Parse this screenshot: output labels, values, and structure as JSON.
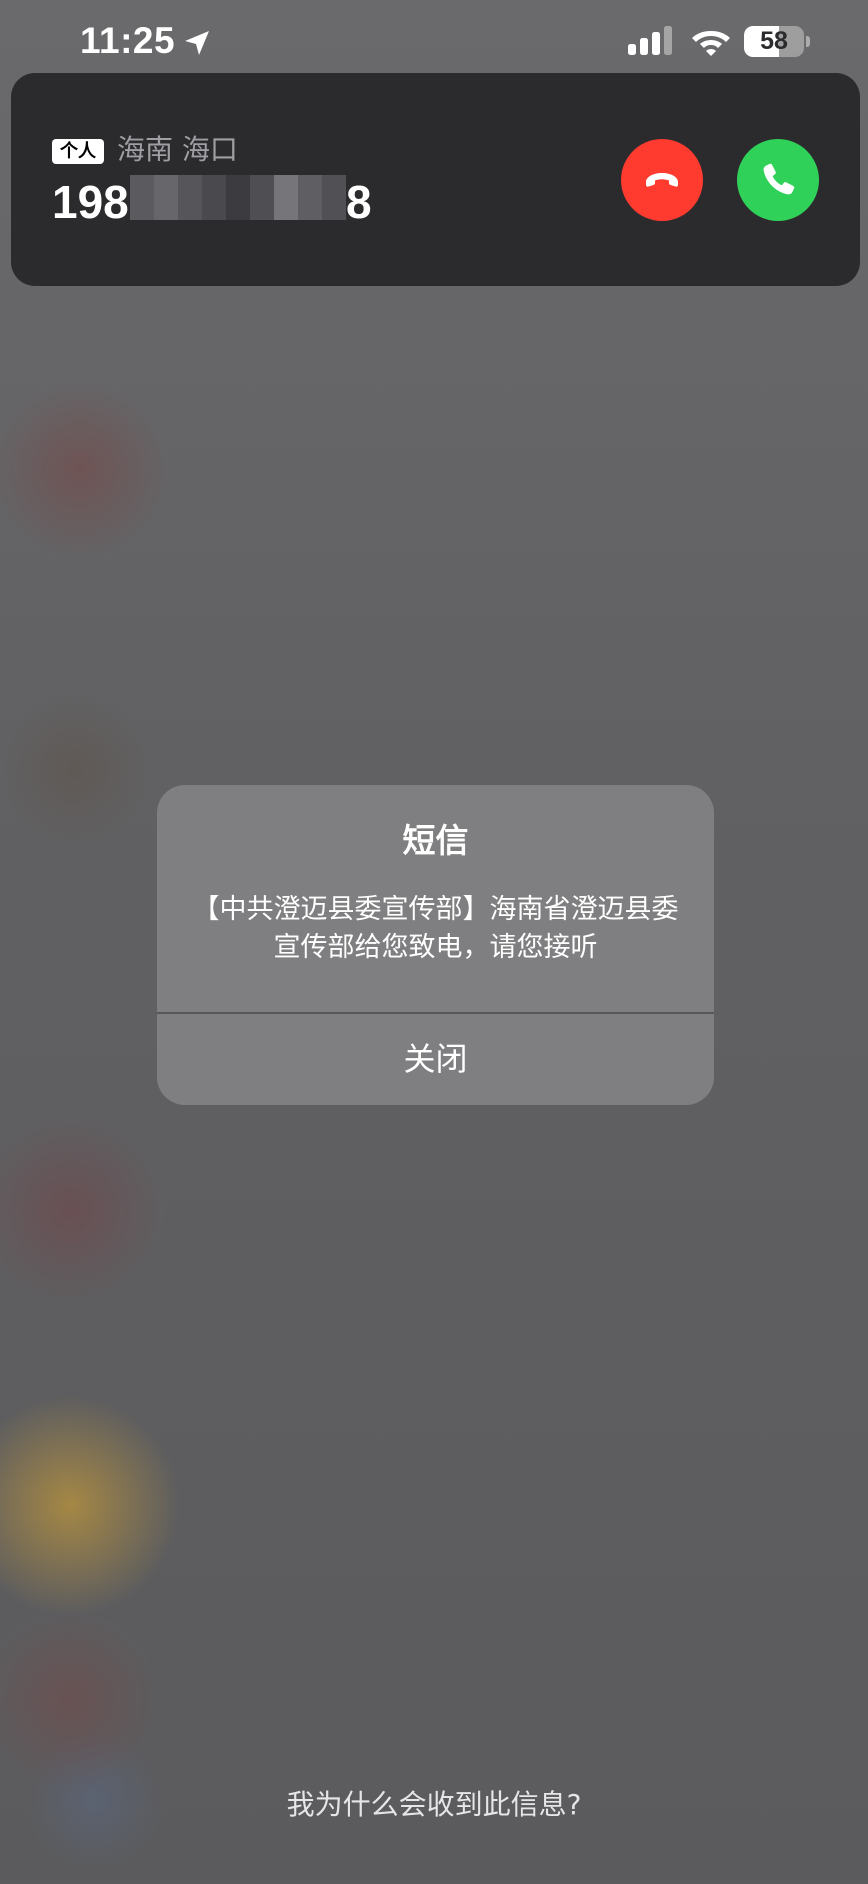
{
  "status_bar": {
    "time": "11:25",
    "battery_level": "58",
    "battery_fraction": 0.58,
    "icons": [
      "location-arrow-icon",
      "cellular-signal-icon",
      "wifi-icon",
      "battery-icon"
    ]
  },
  "incoming_call": {
    "tag": "个人",
    "location": "海南 海口",
    "number_prefix": "198",
    "number_suffix": "8",
    "number_redacted": true,
    "decline_icon": "phone-down-icon",
    "accept_icon": "phone-icon",
    "colors": {
      "background": "#2b2b2e",
      "decline": "#ff3b30",
      "accept": "#30d158"
    }
  },
  "alert": {
    "title": "短信",
    "message": "【中共澄迈县委宣传部】海南省澄迈县委宣传部给您致电，请您接听",
    "close_label": "关闭"
  },
  "footer": {
    "why_link": "我为什么会收到此信息?"
  }
}
